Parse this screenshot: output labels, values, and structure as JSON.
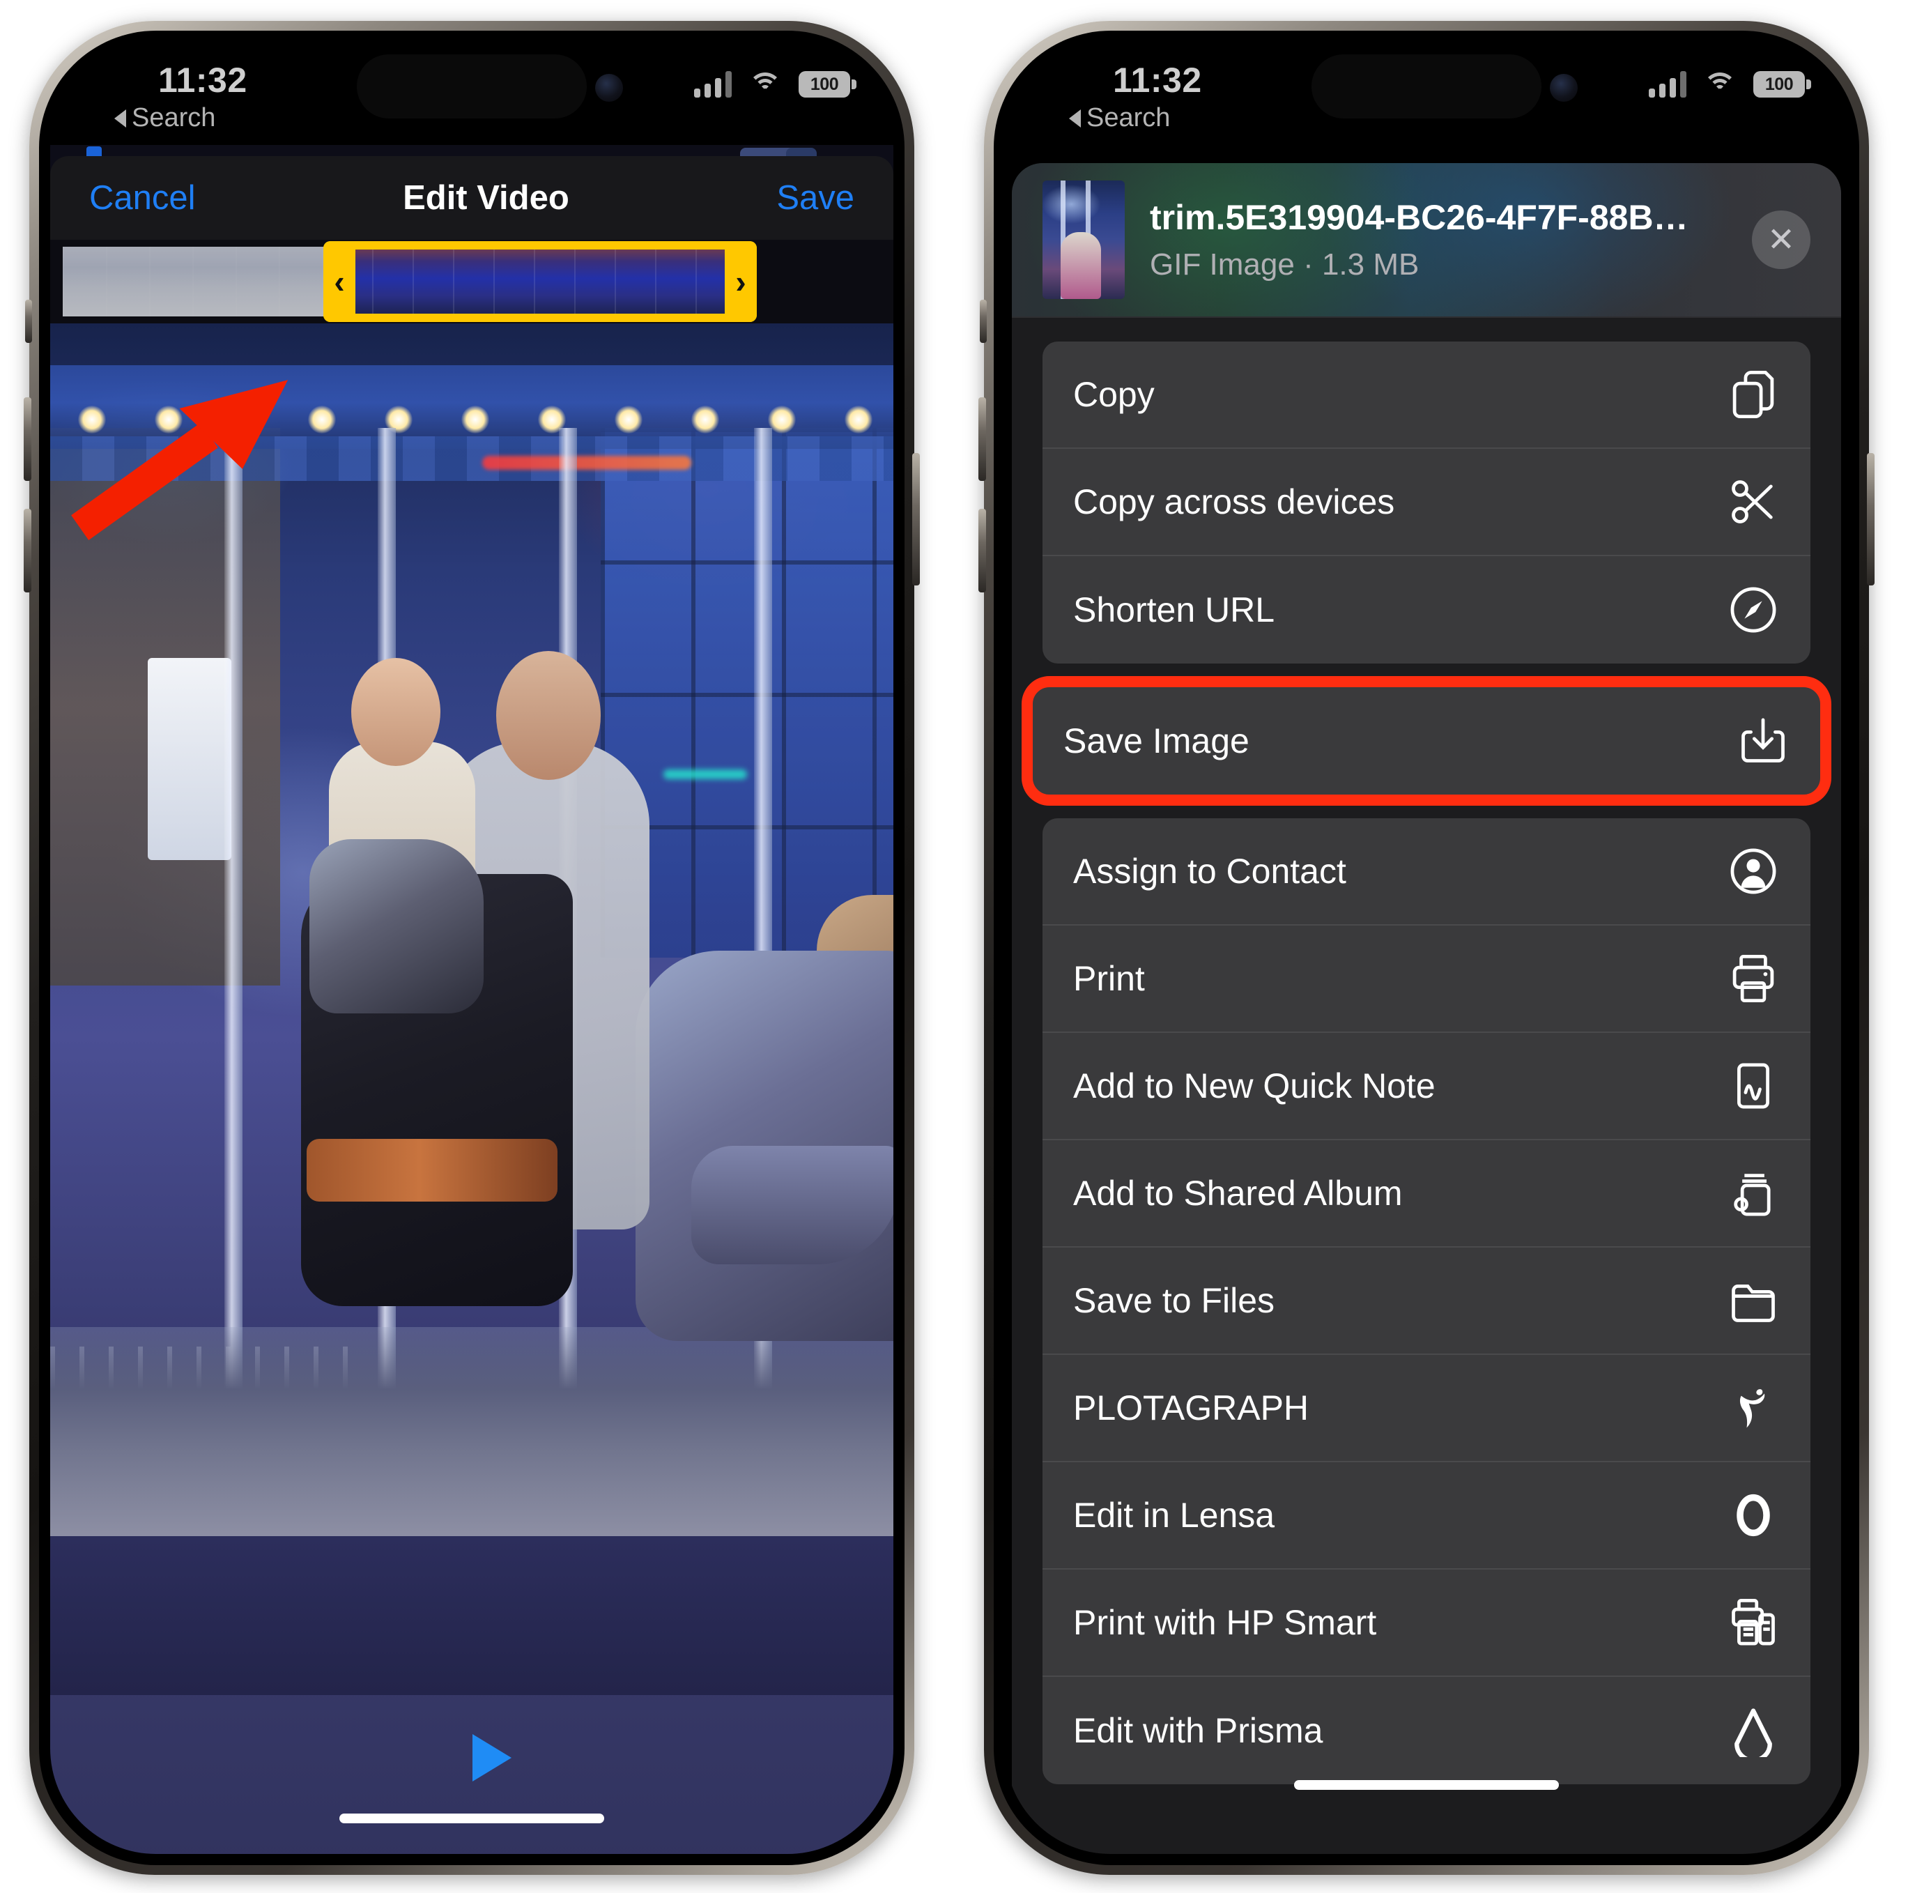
{
  "left_phone": {
    "status": {
      "time": "11:32",
      "back_label": "Search",
      "battery": "100",
      "signal_icon": "cellular-bars-icon",
      "wifi_icon": "wifi-icon",
      "battery_icon": "battery-icon"
    },
    "navbar": {
      "cancel_label": "Cancel",
      "title": "Edit Video",
      "save_label": "Save"
    },
    "trimmer": {
      "left_handle": "‹",
      "right_handle": "›"
    },
    "playbar": {
      "play_icon": "play-triangle-icon"
    },
    "annotation": {
      "arrow_icon": "red-arrow-icon",
      "arrow_color": "#f42000"
    }
  },
  "right_phone": {
    "status": {
      "time": "11:32",
      "back_label": "Search",
      "battery": "100",
      "signal_icon": "cellular-bars-icon",
      "wifi_icon": "wifi-icon",
      "battery_icon": "battery-icon"
    },
    "file": {
      "name": "trim.5E319904-BC26-4F7F-88B…",
      "meta": "GIF Image · 1.3 MB",
      "thumbnail_icon": "file-thumbnail",
      "close_icon": "close-x-icon"
    },
    "highlight_color": "#ff2d10",
    "groups": [
      {
        "rows": [
          {
            "label": "Copy",
            "icon": "copy-documents-icon"
          },
          {
            "label": "Copy across devices",
            "icon": "scissors-icon"
          },
          {
            "label": "Shorten URL",
            "icon": "safari-compass-icon"
          }
        ]
      },
      {
        "highlighted": true,
        "rows": [
          {
            "label": "Save Image",
            "icon": "download-save-icon"
          }
        ]
      },
      {
        "rows": [
          {
            "label": "Assign to Contact",
            "icon": "contact-person-icon"
          },
          {
            "label": "Print",
            "icon": "printer-icon"
          },
          {
            "label": "Add to New Quick Note",
            "icon": "quick-note-icon"
          },
          {
            "label": "Add to Shared Album",
            "icon": "shared-album-icon"
          },
          {
            "label": "Save to Files",
            "icon": "folder-icon"
          },
          {
            "label": "PLOTAGRAPH",
            "icon": "plotagraph-dancer-icon"
          },
          {
            "label": "Edit in Lensa",
            "icon": "lensa-ring-icon"
          },
          {
            "label": "Print with HP Smart",
            "icon": "hp-smart-printer-icon"
          },
          {
            "label": "Edit with Prisma",
            "icon": "prisma-drop-icon"
          }
        ]
      }
    ]
  }
}
